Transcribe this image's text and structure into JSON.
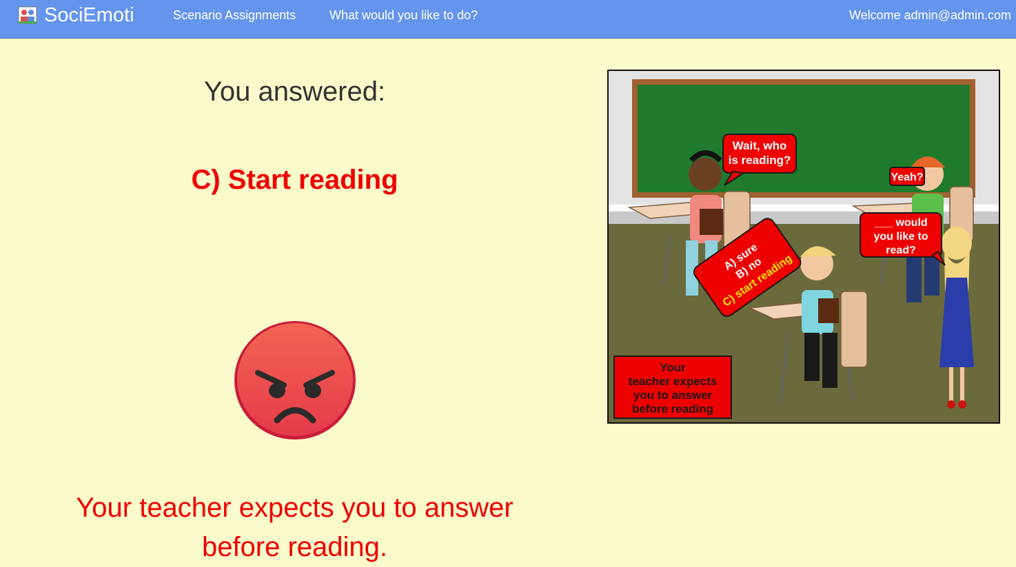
{
  "navbar": {
    "brand": "SociEmoti",
    "links": [
      {
        "label": "Scenario Assignments"
      },
      {
        "label": "What would you like to do?"
      }
    ],
    "welcome": "Welcome admin@admin.com"
  },
  "result": {
    "heading": "You answered:",
    "answer": "C) Start reading",
    "emoji": "angry-face-icon",
    "feedback": "Your teacher expects you to answer before reading."
  },
  "scene": {
    "bubble_girl_line1": "Wait, who",
    "bubble_girl_line2": "is reading?",
    "bubble_boy": "Yeah?",
    "bubble_teacher_line1": "___ would",
    "bubble_teacher_line2": "you like to",
    "bubble_teacher_line3": "read?",
    "bubble_options_a": "A) sure",
    "bubble_options_b": "B) no",
    "bubble_options_c": "C) start reading",
    "caption_line1": "Your",
    "caption_line2": "teacher expects",
    "caption_line3": "you to answer",
    "caption_line4": "before reading"
  },
  "colors": {
    "navbar": "#6495ed",
    "background": "#fafacb",
    "accent_red": "#ee0000"
  }
}
